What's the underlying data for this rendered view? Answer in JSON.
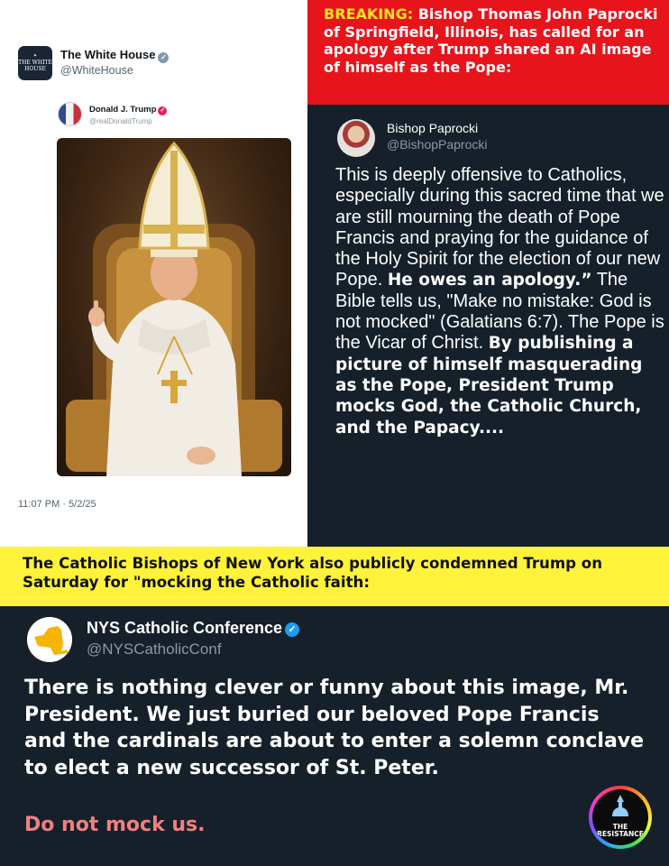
{
  "white_house_tweet": {
    "name": "The White House",
    "handle": "@WhiteHouse",
    "logo_text": "THE WHITE HOUSE",
    "quoted": {
      "name": "Donald J. Trump",
      "handle": "@realDonaldTrump"
    },
    "timestamp": "11:07 PM · 5/2/25"
  },
  "breaking_banner": {
    "label": "BREAKING:",
    "text": "Bishop Thomas John Paprocki of Springfield, Illinois, has called for an apology after Trump shared an AI image of himself as the Pope:"
  },
  "bishop_tweet": {
    "name": "Bishop Paprocki",
    "handle": "@BishopPaprocki",
    "text_1": "This is deeply offensive to Catholics, especially during this sacred time that we are still mourning the death of Pope Francis and praying for the guidance of the Holy Spirit for the election of our new Pope.",
    "bold_1": "He owes an apology.”",
    "text_2": "The Bible tells us, \"Make no mistake: God is not mocked\" (Galatians 6:7). The Pope is the Vicar of Christ.",
    "bold_2": "By publishing a picture of himself masquerading as the Pope, President Trump mocks God, the Catholic Church, and the Papacy...."
  },
  "yellow_banner": {
    "text": "The Catholic Bishops of New York also publicly condemned Trump on Saturday for \"mocking the Catholic faith:"
  },
  "nys_tweet": {
    "name": "NYS Catholic Conference",
    "handle": "@NYSCatholicConf",
    "text": "There is nothing clever or funny about this image, Mr. President. We just buried our beloved Pope Francis and the cardinals are about to enter a solemn conclave to elect a new successor of St. Peter.",
    "closing": "Do not mock us."
  },
  "badge": {
    "line_1": "THE",
    "line_2": "RESISTANCE"
  },
  "colors": {
    "breaking_red": "#e8141b",
    "breaking_label": "#ffe61c",
    "banner_yellow": "#fff23a",
    "dark_bg": "#15202b",
    "verified_blue": "#1d9bf0",
    "closing_pink": "#f08080"
  },
  "icons": [
    "white-house-logo-icon",
    "verified-badge-icon",
    "resistance-logo-icon"
  ]
}
